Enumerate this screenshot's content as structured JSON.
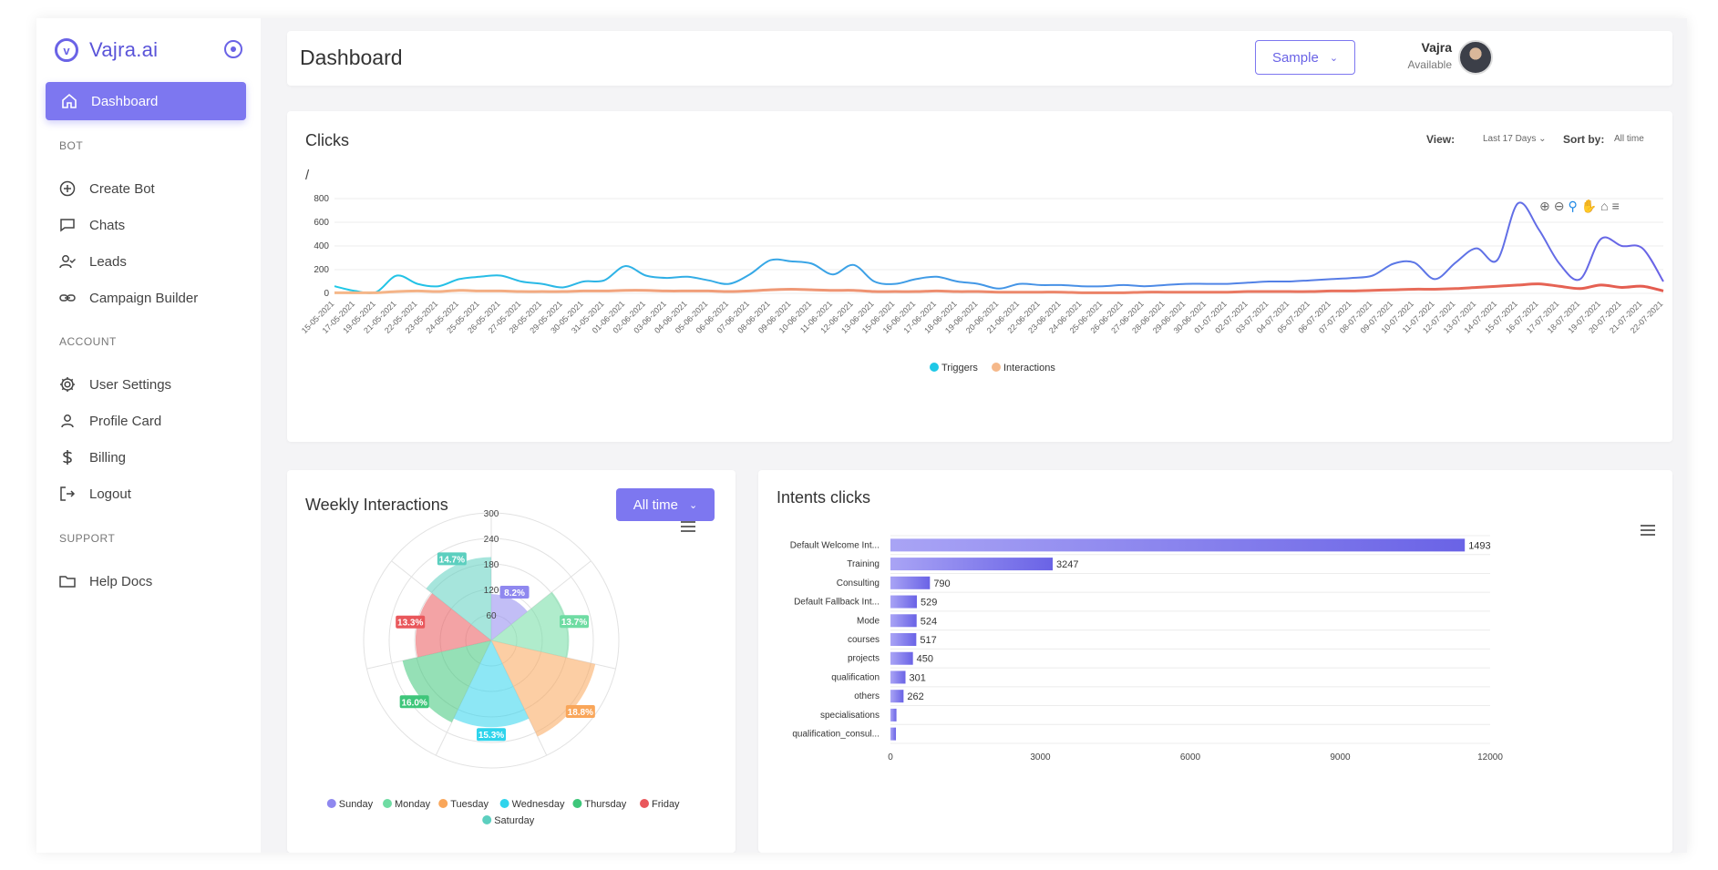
{
  "brand": {
    "name": "Vajra.ai",
    "logo_letter": "v"
  },
  "sidebar": {
    "active": {
      "label": "Dashboard",
      "icon": "home-icon"
    },
    "sections": [
      {
        "heading": "BOT",
        "items": [
          {
            "label": "Create Bot",
            "icon": "plus-circle-icon"
          },
          {
            "label": "Chats",
            "icon": "chat-bubble-icon"
          },
          {
            "label": "Leads",
            "icon": "user-check-icon"
          },
          {
            "label": "Campaign Builder",
            "icon": "link-icon"
          }
        ]
      },
      {
        "heading": "ACCOUNT",
        "items": [
          {
            "label": "User Settings",
            "icon": "gear-icon"
          },
          {
            "label": "Profile Card",
            "icon": "user-icon"
          },
          {
            "label": "Billing",
            "icon": "dollar-icon"
          },
          {
            "label": "Logout",
            "icon": "logout-icon"
          }
        ]
      },
      {
        "heading": "SUPPORT",
        "items": [
          {
            "label": "Help Docs",
            "icon": "folder-icon"
          }
        ]
      }
    ]
  },
  "header": {
    "title": "Dashboard",
    "sample_button": "Sample",
    "user": {
      "name": "Vajra",
      "status": "Available"
    }
  },
  "clicks_card": {
    "title": "Clicks",
    "subtitle": "/",
    "view_label": "View:",
    "view_value": "Last 17 Days",
    "sort_label": "Sort by:",
    "sort_value": "All time"
  },
  "weekly_card": {
    "title": "Weekly Interactions",
    "button": "All time"
  },
  "intents_card": {
    "title": "Intents clicks"
  },
  "colors": {
    "accent": "#7d77f0",
    "triggers": "#1ec8e6",
    "triggers_line": "#6a63e6",
    "interactions": "#f5b88a",
    "interactions_line": "#e45b4f"
  },
  "chart_data": [
    {
      "type": "line",
      "x": [
        "15-05-2021",
        "17-05-2021",
        "19-05-2021",
        "21-05-2021",
        "22-05-2021",
        "23-05-2021",
        "24-05-2021",
        "25-05-2021",
        "26-05-2021",
        "27-05-2021",
        "28-05-2021",
        "29-05-2021",
        "30-05-2021",
        "31-05-2021",
        "01-06-2021",
        "02-06-2021",
        "03-06-2021",
        "04-06-2021",
        "05-06-2021",
        "06-06-2021",
        "07-06-2021",
        "08-06-2021",
        "09-06-2021",
        "10-06-2021",
        "11-06-2021",
        "12-06-2021",
        "13-06-2021",
        "15-06-2021",
        "16-06-2021",
        "17-06-2021",
        "18-06-2021",
        "19-06-2021",
        "20-06-2021",
        "21-06-2021",
        "22-06-2021",
        "23-06-2021",
        "24-06-2021",
        "25-06-2021",
        "26-06-2021",
        "27-06-2021",
        "28-06-2021",
        "29-06-2021",
        "30-06-2021",
        "01-07-2021",
        "02-07-2021",
        "03-07-2021",
        "04-07-2021",
        "05-07-2021",
        "06-07-2021",
        "07-07-2021",
        "08-07-2021",
        "09-07-2021",
        "10-07-2021",
        "11-07-2021",
        "12-07-2021",
        "13-07-2021",
        "14-07-2021",
        "15-07-2021",
        "16-07-2021",
        "17-07-2021",
        "18-07-2021",
        "19-07-2021",
        "20-07-2021",
        "21-07-2021",
        "22-07-2021"
      ],
      "series": [
        {
          "name": "Triggers",
          "values": [
            60,
            20,
            10,
            150,
            80,
            60,
            120,
            140,
            150,
            100,
            80,
            50,
            100,
            110,
            230,
            150,
            130,
            140,
            110,
            80,
            160,
            280,
            270,
            250,
            160,
            240,
            100,
            80,
            120,
            140,
            100,
            80,
            40,
            80,
            70,
            70,
            60,
            60,
            70,
            60,
            70,
            80,
            80,
            80,
            90,
            100,
            100,
            110,
            120,
            130,
            150,
            250,
            260,
            120,
            260,
            380,
            280,
            760,
            540,
            250,
            120,
            460,
            400,
            380,
            100
          ]
        },
        {
          "name": "Interactions",
          "values": [
            5,
            5,
            5,
            15,
            20,
            15,
            25,
            20,
            20,
            15,
            15,
            15,
            20,
            20,
            25,
            25,
            20,
            20,
            20,
            15,
            20,
            30,
            35,
            30,
            25,
            25,
            15,
            15,
            15,
            20,
            15,
            15,
            10,
            10,
            10,
            10,
            5,
            5,
            5,
            10,
            10,
            10,
            10,
            10,
            15,
            15,
            15,
            15,
            20,
            20,
            25,
            30,
            35,
            35,
            40,
            50,
            60,
            70,
            80,
            60,
            40,
            70,
            50,
            60,
            20
          ]
        }
      ],
      "ylim": [
        0,
        800
      ],
      "yticks": [
        0,
        200,
        400,
        600,
        800
      ],
      "legend": "bottom-center"
    },
    {
      "type": "polar",
      "categories": [
        "Sunday",
        "Monday",
        "Tuesday",
        "Wednesday",
        "Thursday",
        "Friday",
        "Saturday"
      ],
      "values": [
        109,
        183,
        251,
        204,
        214,
        178,
        196
      ],
      "percent_labels": [
        "8.2%",
        "13.7%",
        "18.8%",
        "15.3%",
        "16.0%",
        "13.3%",
        "14.7%"
      ],
      "colors": [
        "#8f88ef",
        "#6fdca3",
        "#f9a65a",
        "#2fd4ec",
        "#3ec67a",
        "#e9575b",
        "#5ccfbf"
      ],
      "rlim": [
        0,
        300
      ],
      "rticks": [
        60,
        120,
        180,
        240,
        300
      ],
      "legend": "bottom-center"
    },
    {
      "type": "bar",
      "orientation": "horizontal",
      "categories": [
        "Default Welcome Int...",
        "Training",
        "Consulting",
        "Default Fallback Int...",
        "Mode",
        "courses",
        "projects",
        "qualification",
        "others",
        "specialisations",
        "qualification_consul..."
      ],
      "values": [
        11493,
        3247,
        790,
        529,
        524,
        517,
        450,
        301,
        262,
        120,
        110
      ],
      "value_labels": [
        "1493",
        "3247",
        "790",
        "529",
        "524",
        "517",
        "450",
        "301",
        "262",
        "",
        ""
      ],
      "xlim": [
        0,
        12000
      ],
      "xticks": [
        0,
        3000,
        6000,
        9000,
        12000
      ]
    }
  ]
}
